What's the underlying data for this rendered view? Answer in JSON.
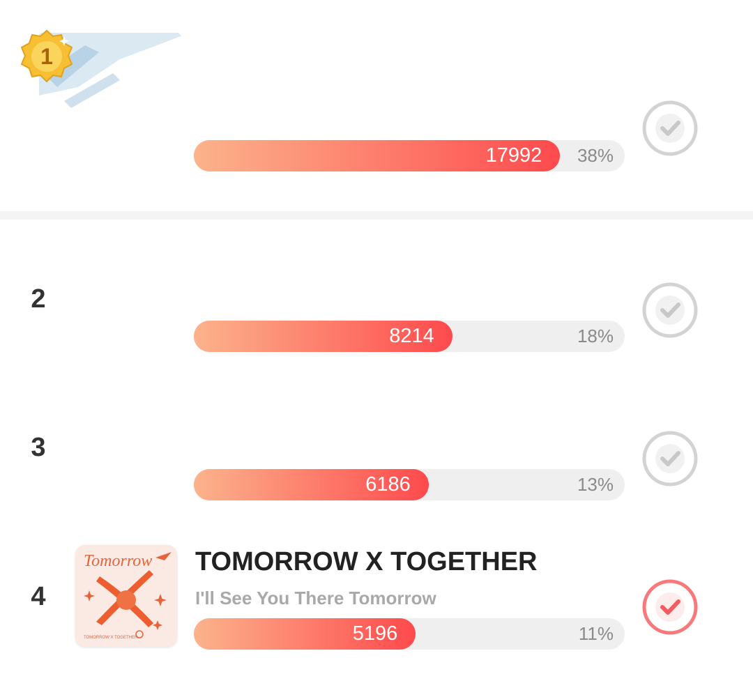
{
  "colors": {
    "bar_start": "#fcb38c",
    "bar_end": "#fe4a4d",
    "track": "#efefef",
    "check_default": "#d3d3d3",
    "check_selected": "#f6797b",
    "medal_gold": "#f7c034"
  },
  "entries": [
    {
      "rank": "1",
      "badge": "1",
      "title": "",
      "subtitle": "",
      "votes": "17992",
      "percent": "38%",
      "fill": 0.85,
      "selected": false
    },
    {
      "rank": "2",
      "title": "",
      "subtitle": "",
      "votes": "8214",
      "percent": "18%",
      "fill": 0.6,
      "selected": false
    },
    {
      "rank": "3",
      "title": "",
      "subtitle": "",
      "votes": "6186",
      "percent": "13%",
      "fill": 0.545,
      "selected": false
    },
    {
      "rank": "4",
      "title": "TOMORROW X TOGETHER",
      "subtitle": "I'll See You There Tomorrow",
      "cover_text": "Tomorrow",
      "cover_small": "TOMORROW X TOGETHER",
      "votes": "5196",
      "percent": "11%",
      "fill": 0.515,
      "selected": true
    }
  ]
}
